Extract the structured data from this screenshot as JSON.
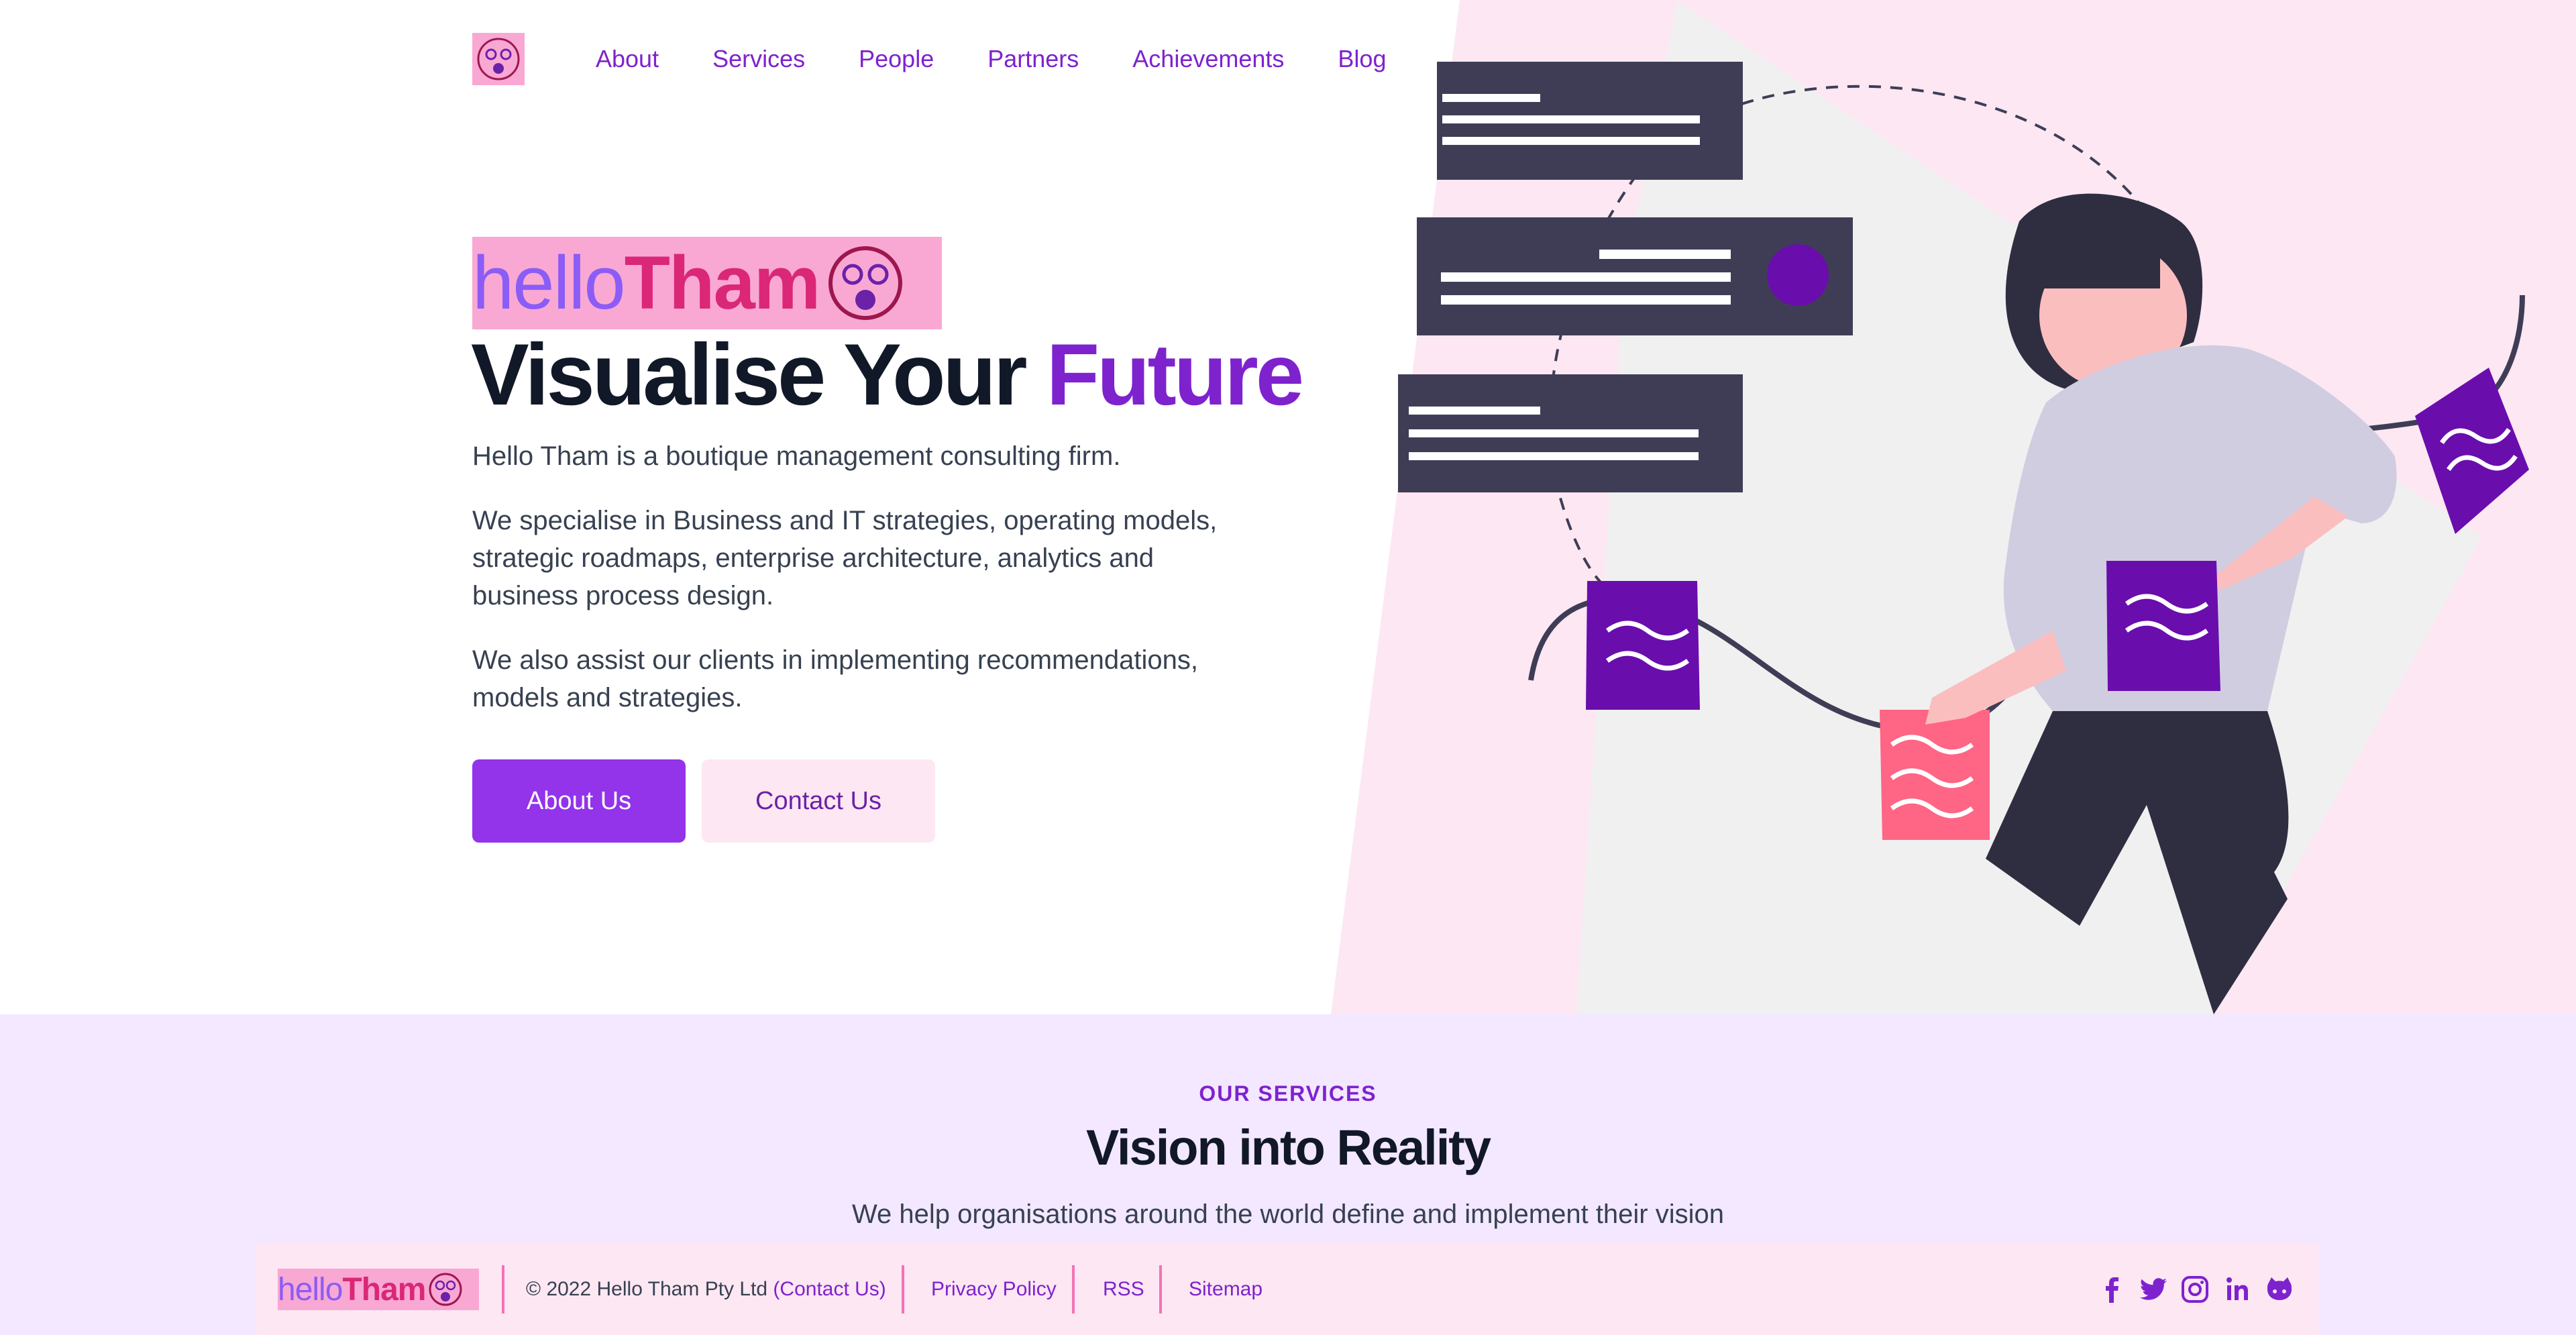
{
  "colors": {
    "accent": "#7e22ce",
    "brand_pink": "#f9a8d4",
    "brand_rose": "#db2777",
    "hero_bg_right": "#fce7f3",
    "services_bg": "#f3e8ff"
  },
  "nav": {
    "logo_icon": "hellotham-face-logo",
    "links": [
      "About",
      "Services",
      "People",
      "Partners",
      "Achievements",
      "Blog"
    ]
  },
  "hero": {
    "brand_hello": "hello",
    "brand_tham": "Tham",
    "headline_main": "Visualise Your ",
    "headline_accent": "Future",
    "paragraphs": [
      "Hello Tham is a boutique management consulting firm.",
      "We specialise in Business and IT strategies, operating models, strategic roadmaps, enterprise architecture, analytics and business process design.",
      "We also assist our clients in implementing recommendations, models and strategies."
    ],
    "buttons": {
      "about": "About Us",
      "contact": "Contact Us"
    },
    "illustration": "woman-with-flags-illustration"
  },
  "services": {
    "eyebrow": "OUR SERVICES",
    "title": "Vision into Reality",
    "subtitle": "We help organisations around the world define and implement their vision"
  },
  "footer": {
    "brand_hello": "hello",
    "brand_tham": "Tham",
    "copyright": "© 2022 Hello Tham Pty Ltd",
    "contact_link": "(Contact Us)",
    "links": [
      "Privacy Policy",
      "RSS",
      "Sitemap"
    ],
    "social_icons": [
      "facebook-icon",
      "twitter-icon",
      "instagram-icon",
      "linkedin-icon",
      "github-icon"
    ]
  }
}
